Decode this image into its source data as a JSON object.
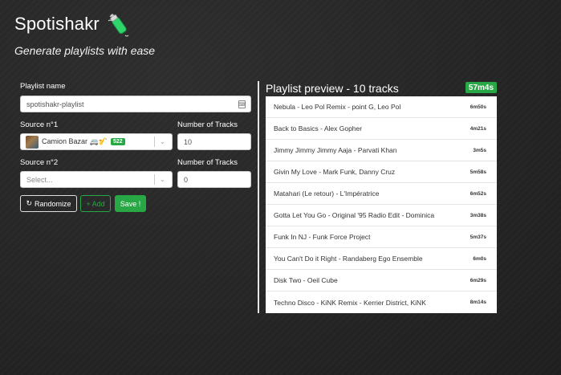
{
  "app": {
    "title": "Spotishakr",
    "subtitle": "Generate playlists with ease"
  },
  "form": {
    "playlist_name_label": "Playlist name",
    "playlist_name_value": "spotishakr-playlist",
    "source1_label": "Source n°1",
    "source1_value": "Camion Bazar 🚐🎷",
    "source1_badge": "522",
    "tracks1_label": "Number of Tracks",
    "tracks1_value": "10",
    "source2_label": "Source n°2",
    "source2_placeholder": "Select...",
    "tracks2_label": "Number of Tracks",
    "tracks2_value": "0"
  },
  "buttons": {
    "randomize": "Randomize",
    "add": "+ Add",
    "save": "Save !"
  },
  "preview": {
    "title": "Playlist preview - 10 tracks",
    "total_duration": "57m4s",
    "tracks": [
      {
        "name": "Nebula - Leo Pol Remix - point G, Leo Pol",
        "duration": "6m50s"
      },
      {
        "name": "Back to Basics - Alex Gopher",
        "duration": "4m21s"
      },
      {
        "name": "Jimmy Jimmy Jimmy Aaja - Parvati Khan",
        "duration": "3m5s"
      },
      {
        "name": "Givin My Love - Mark Funk, Danny Cruz",
        "duration": "5m58s"
      },
      {
        "name": "Matahari (Le retour) - L'Impératrice",
        "duration": "6m52s"
      },
      {
        "name": "Gotta Let You Go - Original '95 Radio Edit - Dominica",
        "duration": "3m38s"
      },
      {
        "name": "Funk In NJ - Funk Force Project",
        "duration": "5m37s"
      },
      {
        "name": "You Can't Do it Right - Randaberg Ego Ensemble",
        "duration": "6m0s"
      },
      {
        "name": "Disk Two - Oeil Cube",
        "duration": "6m29s"
      },
      {
        "name": "Techno Disco - KiNK Remix - Kerrier District, KiNK",
        "duration": "8m14s"
      }
    ]
  },
  "colors": {
    "accent": "#28a745",
    "background": "#262626"
  }
}
